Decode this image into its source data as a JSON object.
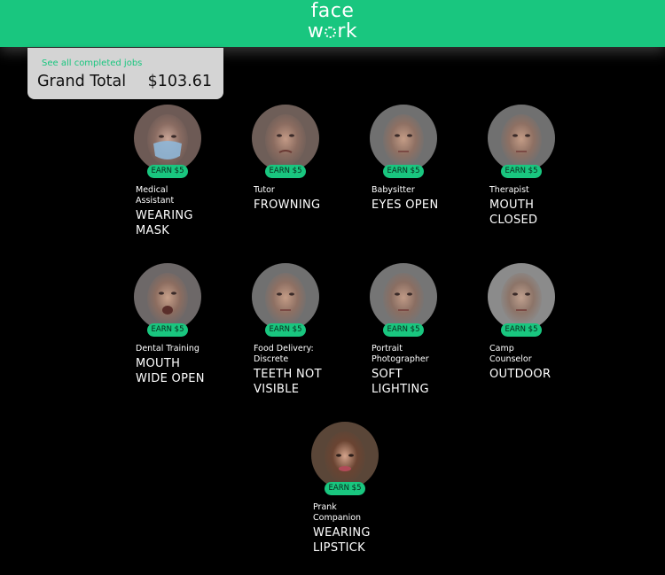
{
  "header": {
    "logo_top": "face",
    "logo_bottom_prefix": "w",
    "logo_bottom_suffix": "rk",
    "bar_color": "#19c67f"
  },
  "total_card": {
    "link": "See all completed jobs",
    "label": "Grand Total",
    "value": "$103.61"
  },
  "jobs": [
    {
      "earn": "EARN $5",
      "title_lines": [
        "Medical",
        "Assistant"
      ],
      "req_lines": [
        "WEARING",
        "MASK"
      ],
      "face": "masked-face"
    },
    {
      "earn": "EARN $5",
      "title_lines": [
        "Tutor"
      ],
      "req_lines": [
        "FROWNING"
      ],
      "face": "frowning-face"
    },
    {
      "earn": "EARN $5",
      "title_lines": [
        "Babysitter"
      ],
      "req_lines": [
        "EYES OPEN"
      ],
      "face": "neutral-face"
    },
    {
      "earn": "EARN $5",
      "title_lines": [
        "Therapist"
      ],
      "req_lines": [
        "MOUTH",
        "CLOSED"
      ],
      "face": "neutral-face"
    },
    {
      "earn": "EARN $5",
      "title_lines": [
        "Dental Training"
      ],
      "req_lines": [
        "MOUTH",
        "WIDE OPEN"
      ],
      "face": "open-mouth-face"
    },
    {
      "earn": "EARN $5",
      "title_lines": [
        "Food Delivery:",
        "Discrete"
      ],
      "req_lines": [
        "TEETH NOT",
        "VISIBLE"
      ],
      "face": "neutral-face"
    },
    {
      "earn": "EARN $5",
      "title_lines": [
        "Portrait",
        "Photographer"
      ],
      "req_lines": [
        "SOFT",
        "LIGHTING"
      ],
      "face": "soft-face"
    },
    {
      "earn": "EARN $5",
      "title_lines": [
        "Camp",
        "Counselor"
      ],
      "req_lines": [
        "OUTDOOR"
      ],
      "face": "outdoor-face"
    },
    {
      "earn": "EARN $5",
      "title_lines": [
        "Prank",
        "Companion"
      ],
      "req_lines": [
        "WEARING",
        "LIPSTICK"
      ],
      "face": "lipstick-face"
    }
  ]
}
